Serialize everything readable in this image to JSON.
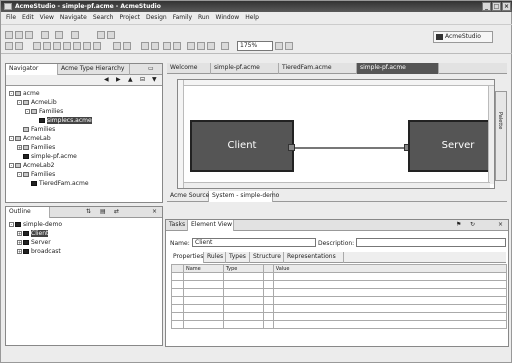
{
  "window": {
    "title": "AcmeStudio - simple-pf.acme - AcmeStudio"
  },
  "menu": [
    "File",
    "Edit",
    "View",
    "Navigate",
    "Search",
    "Project",
    "Design",
    "Family",
    "Run",
    "Window",
    "Help"
  ],
  "toolbar": {
    "zoom_value": "175%"
  },
  "perspective": {
    "label": "AcmeStudio"
  },
  "navigator": {
    "tabs": [
      "Navigator",
      "Acme Type Hierarchy"
    ],
    "tree": [
      {
        "label": "acme",
        "indent": 0,
        "icon": "folder",
        "toggle": "-"
      },
      {
        "label": "AcmeLib",
        "indent": 1,
        "icon": "folder",
        "toggle": "-"
      },
      {
        "label": "Families",
        "indent": 2,
        "icon": "folder",
        "toggle": "-"
      },
      {
        "label": "simplecs.acme",
        "indent": 3,
        "icon": "file",
        "selected": true
      },
      {
        "label": "Families",
        "indent": 1,
        "icon": "folder",
        "toggle": ""
      },
      {
        "label": "AcmeLab",
        "indent": 0,
        "icon": "folder",
        "toggle": "-"
      },
      {
        "label": "Families",
        "indent": 1,
        "icon": "folder",
        "toggle": "+"
      },
      {
        "label": "simple-pf.acme",
        "indent": 1,
        "icon": "file"
      },
      {
        "label": "AcmeLab2",
        "indent": 0,
        "icon": "folder",
        "toggle": "-"
      },
      {
        "label": "Families",
        "indent": 1,
        "icon": "folder",
        "toggle": "-"
      },
      {
        "label": "TieredFam.acme",
        "indent": 2,
        "icon": "file"
      }
    ]
  },
  "editor": {
    "tabs": [
      "Welcome",
      "simple-pf.acme",
      "TieredFam.acme",
      "simple-pf.acme"
    ],
    "components": [
      {
        "label": "Client"
      },
      {
        "label": "Server"
      }
    ],
    "bottom_tabs": [
      "Acme Source",
      "System - simple-demo"
    ]
  },
  "palette": {
    "label": "Palette"
  },
  "outline": {
    "tab": "Outline",
    "tree": [
      {
        "label": "simple-demo",
        "indent": 0,
        "toggle": "-"
      },
      {
        "label": "Client",
        "indent": 1,
        "toggle": "+",
        "selected": true
      },
      {
        "label": "Server",
        "indent": 1,
        "toggle": "+"
      },
      {
        "label": "broadcast",
        "indent": 1,
        "toggle": "+"
      }
    ]
  },
  "element_view": {
    "tabs": [
      "Tasks",
      "Element View"
    ],
    "name_label": "Name:",
    "name_value": "Client",
    "description_label": "Description:",
    "description_value": "",
    "sub_tabs": [
      "Properties",
      "Rules",
      "Types",
      "Structure",
      "Representations"
    ],
    "columns": [
      "",
      "Name",
      "Type",
      "",
      "Value"
    ],
    "rows": 7
  }
}
